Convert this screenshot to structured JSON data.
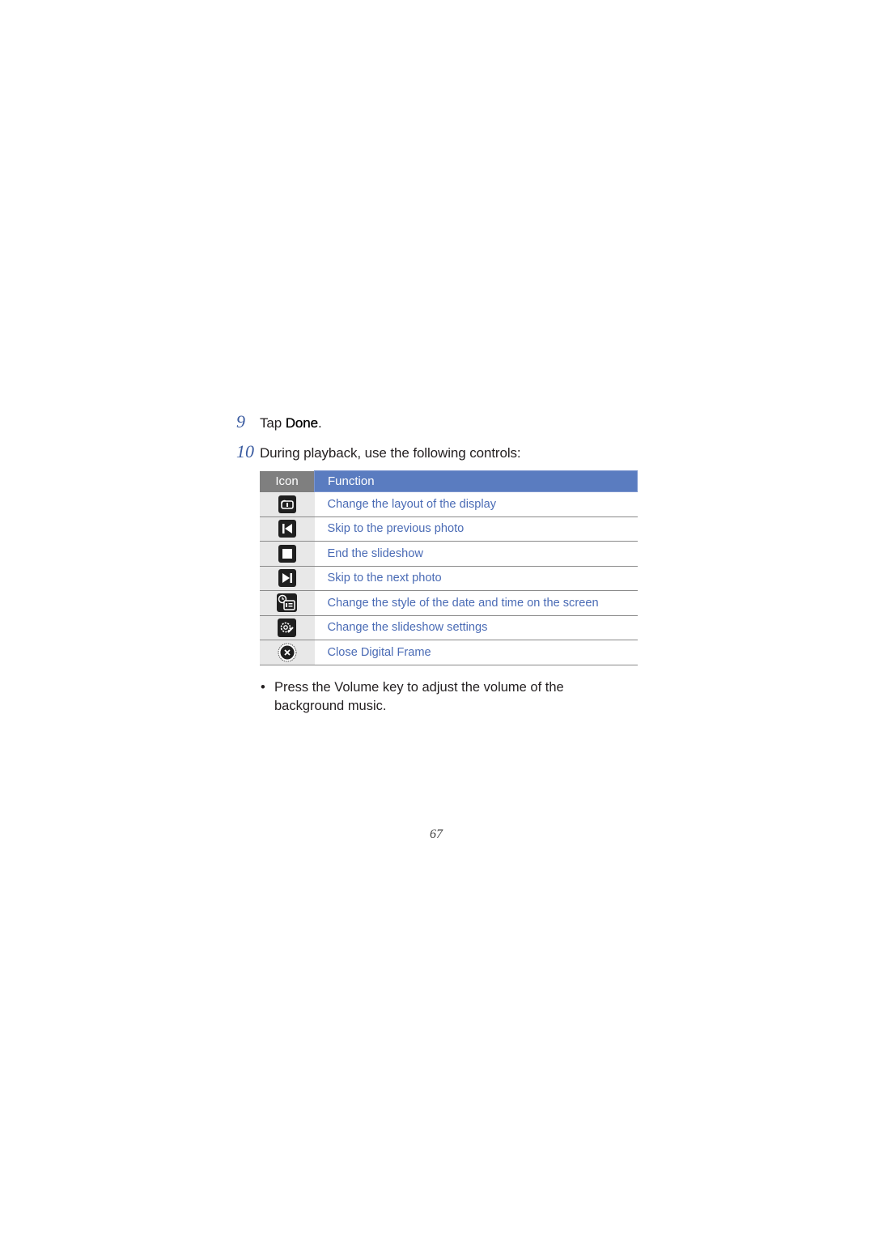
{
  "steps": [
    {
      "number": "9",
      "prefix": "Tap ",
      "emphasis": "Done",
      "suffix": "."
    },
    {
      "number": "10",
      "text": "During playback, use the following controls:"
    }
  ],
  "table": {
    "headers": {
      "icon": "Icon",
      "function": "Function"
    },
    "rows": [
      {
        "icon": "layout-display-icon",
        "function": "Change the layout of the display"
      },
      {
        "icon": "skip-previous-icon",
        "function": "Skip to the previous photo"
      },
      {
        "icon": "stop-icon",
        "function": "End the slideshow"
      },
      {
        "icon": "skip-next-icon",
        "function": "Skip to the next photo"
      },
      {
        "icon": "clock-calendar-icon",
        "function": "Change the style of the date and time on the screen"
      },
      {
        "icon": "settings-gear-icon",
        "function": "Change the slideshow settings"
      },
      {
        "icon": "close-circle-icon",
        "function": "Close Digital Frame"
      }
    ],
    "colors": {
      "header_icon_bg": "#7f7f7f",
      "header_function_bg": "#5a7cc0",
      "function_text": "#4a6bb5",
      "icon_col_bg": "#e8e8e8"
    }
  },
  "bullet": {
    "symbol": "•",
    "text": "Press the Volume key to adjust the volume of the background music."
  },
  "page_number": "67"
}
